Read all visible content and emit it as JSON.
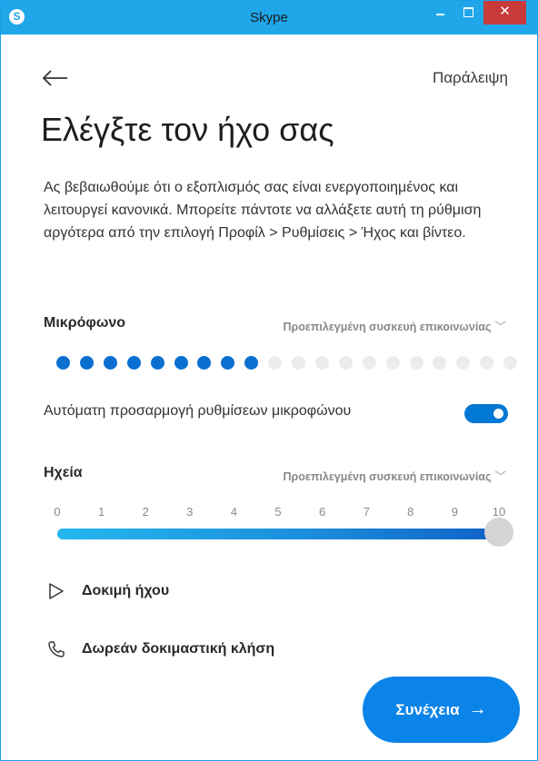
{
  "window": {
    "title": "Skype",
    "app_icon": "S",
    "close_glyph": "✕"
  },
  "header": {
    "back_icon": "arrow-left-icon",
    "skip_label": "Παράλειψη"
  },
  "page": {
    "title": "Ελέγξτε τον ήχο σας",
    "intro": "Ας βεβαιωθούμε ότι ο εξοπλισμός σας είναι ενεργοποιημένος και λειτουργεί κανονικά. Μπορείτε πάντοτε να αλλάξετε αυτή τη ρύθμιση αργότερα από την επιλογή Προφίλ > Ρυθμίσεις > Ήχος και βίντεο."
  },
  "microphone": {
    "label": "Μικρόφωνο",
    "device": "Προεπιλεγμένη συσκευή επικοινωνίας",
    "level_total": 20,
    "level_active": 9,
    "auto_adjust_label": "Αυτόματη προσαρμογή ρυθμίσεων μικροφώνου",
    "auto_adjust_on": true
  },
  "speakers": {
    "label": "Ηχεία",
    "device": "Προεπιλεγμένη συσκευή επικοινωνίας",
    "ticks": [
      "0",
      "1",
      "2",
      "3",
      "4",
      "5",
      "6",
      "7",
      "8",
      "9",
      "10"
    ],
    "volume": 10,
    "volume_max": 10
  },
  "actions": {
    "test_sound_label": "Δοκιμή ήχου",
    "test_sound_icon": "play-icon",
    "test_call_label": "Δωρεάν δοκιμαστική κλήση",
    "test_call_icon": "phone-icon"
  },
  "footer": {
    "continue_label": "Συνέχεια",
    "continue_icon": "arrow-right-icon"
  },
  "colors": {
    "titlebar": "#1fa7ea",
    "accent": "#0078d4",
    "mic_dot_active": "#0a6fd0",
    "mic_dot_inactive": "#ececec"
  }
}
